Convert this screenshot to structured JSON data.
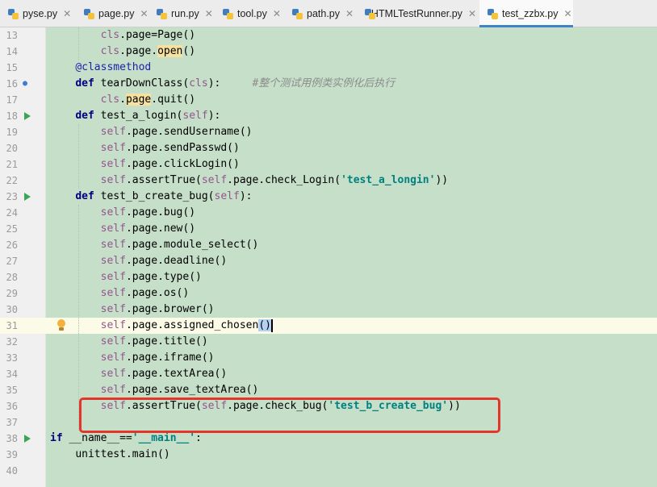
{
  "tabs": [
    {
      "label": "pyse.py",
      "active": false
    },
    {
      "label": "page.py",
      "active": false
    },
    {
      "label": "run.py",
      "active": false
    },
    {
      "label": "tool.py",
      "active": false
    },
    {
      "label": "path.py",
      "active": false
    },
    {
      "label": "HTMLTestRunner.py",
      "active": false
    },
    {
      "label": "test_zzbx.py",
      "active": true
    }
  ],
  "close_glyph": "✕",
  "editor": {
    "line_numbers": [
      "13",
      "14",
      "15",
      "16",
      "17",
      "18",
      "19",
      "20",
      "21",
      "22",
      "23",
      "24",
      "25",
      "26",
      "27",
      "28",
      "29",
      "30",
      "31",
      "32",
      "33",
      "34",
      "35",
      "36",
      "37",
      "38",
      "39",
      "40"
    ],
    "lines": [
      {
        "indent": "        ",
        "parts": [
          [
            "sf",
            "cls"
          ],
          [
            "",
            "."
          ],
          [
            "",
            "page=Page()"
          ]
        ]
      },
      {
        "indent": "        ",
        "parts": [
          [
            "sf",
            "cls"
          ],
          [
            "",
            ".page."
          ],
          [
            "hl",
            "open"
          ],
          [
            "",
            "()"
          ]
        ]
      },
      {
        "indent": "    ",
        "parts": [
          [
            "dc",
            "@classmethod"
          ]
        ]
      },
      {
        "indent": "    ",
        "parts": [
          [
            "k",
            "def"
          ],
          [
            "",
            " tearDownClass("
          ],
          [
            "sf",
            "cls"
          ],
          [
            "",
            "):     "
          ],
          [
            "cm",
            "#整个测试用例类实例化后执行"
          ]
        ]
      },
      {
        "indent": "        ",
        "parts": [
          [
            "sf",
            "cls"
          ],
          [
            "",
            "."
          ],
          [
            "hl",
            "page"
          ],
          [
            "",
            ".quit()"
          ]
        ]
      },
      {
        "indent": "    ",
        "parts": [
          [
            "k",
            "def"
          ],
          [
            "",
            " test_a_login("
          ],
          [
            "sf",
            "self"
          ],
          [
            "",
            "):"
          ]
        ]
      },
      {
        "indent": "        ",
        "parts": [
          [
            "sf",
            "self"
          ],
          [
            "",
            ".page.sendUsername()"
          ]
        ]
      },
      {
        "indent": "        ",
        "parts": [
          [
            "sf",
            "self"
          ],
          [
            "",
            ".page.sendPasswd()"
          ]
        ]
      },
      {
        "indent": "        ",
        "parts": [
          [
            "sf",
            "self"
          ],
          [
            "",
            ".page.clickLogin()"
          ]
        ]
      },
      {
        "indent": "        ",
        "parts": [
          [
            "sf",
            "self"
          ],
          [
            "",
            ".assertTrue("
          ],
          [
            "sf",
            "self"
          ],
          [
            "",
            ".page.check_Login("
          ],
          [
            "s",
            "'test_a_longin'"
          ],
          [
            "",
            "))"
          ]
        ]
      },
      {
        "indent": "    ",
        "parts": [
          [
            "k",
            "def"
          ],
          [
            "",
            " test_b_create_bug("
          ],
          [
            "sf",
            "self"
          ],
          [
            "",
            "):"
          ]
        ]
      },
      {
        "indent": "        ",
        "parts": [
          [
            "sf",
            "self"
          ],
          [
            "",
            ".page.bug()"
          ]
        ]
      },
      {
        "indent": "        ",
        "parts": [
          [
            "sf",
            "self"
          ],
          [
            "",
            ".page.new()"
          ]
        ]
      },
      {
        "indent": "        ",
        "parts": [
          [
            "sf",
            "self"
          ],
          [
            "",
            ".page.module_select()"
          ]
        ]
      },
      {
        "indent": "        ",
        "parts": [
          [
            "sf",
            "self"
          ],
          [
            "",
            ".page.deadline()"
          ]
        ]
      },
      {
        "indent": "        ",
        "parts": [
          [
            "sf",
            "self"
          ],
          [
            "",
            ".page.type()"
          ]
        ]
      },
      {
        "indent": "        ",
        "parts": [
          [
            "sf",
            "self"
          ],
          [
            "",
            ".page.os()"
          ]
        ]
      },
      {
        "indent": "        ",
        "parts": [
          [
            "sf",
            "self"
          ],
          [
            "",
            ".page.brower()"
          ]
        ]
      },
      {
        "indent": "        ",
        "parts": [
          [
            "sf",
            "self"
          ],
          [
            "",
            ".page.assigned_chosen"
          ],
          [
            "hl2",
            "()"
          ]
        ]
      },
      {
        "indent": "        ",
        "parts": [
          [
            "sf",
            "self"
          ],
          [
            "",
            ".page.title()"
          ]
        ]
      },
      {
        "indent": "        ",
        "parts": [
          [
            "sf",
            "self"
          ],
          [
            "",
            ".page.iframe()"
          ]
        ]
      },
      {
        "indent": "        ",
        "parts": [
          [
            "sf",
            "self"
          ],
          [
            "",
            ".page.textArea()"
          ]
        ]
      },
      {
        "indent": "        ",
        "parts": [
          [
            "sf",
            "self"
          ],
          [
            "",
            ".page.save_textArea()"
          ]
        ]
      },
      {
        "indent": "        ",
        "parts": [
          [
            "sf",
            "self"
          ],
          [
            "",
            ".assertTrue("
          ],
          [
            "sf",
            "self"
          ],
          [
            "",
            ".page.check_bug("
          ],
          [
            "s",
            "'test_b_create_bug'"
          ],
          [
            "",
            "))"
          ]
        ]
      },
      {
        "indent": "",
        "parts": []
      },
      {
        "indent": "",
        "parts": [
          [
            "k",
            "if"
          ],
          [
            "",
            " __name__=="
          ],
          [
            "s",
            "'__main__'"
          ],
          [
            "",
            ":"
          ]
        ]
      },
      {
        "indent": "    ",
        "parts": [
          [
            "",
            "unittest.main()"
          ]
        ]
      },
      {
        "indent": "",
        "parts": []
      }
    ]
  },
  "colors": {
    "editor_bg": "#c5dfc8",
    "current_line": "#fbfbe8",
    "keyword": "#000080",
    "string": "#008080",
    "self": "#94558d",
    "highlight_box": "#e4352b"
  }
}
